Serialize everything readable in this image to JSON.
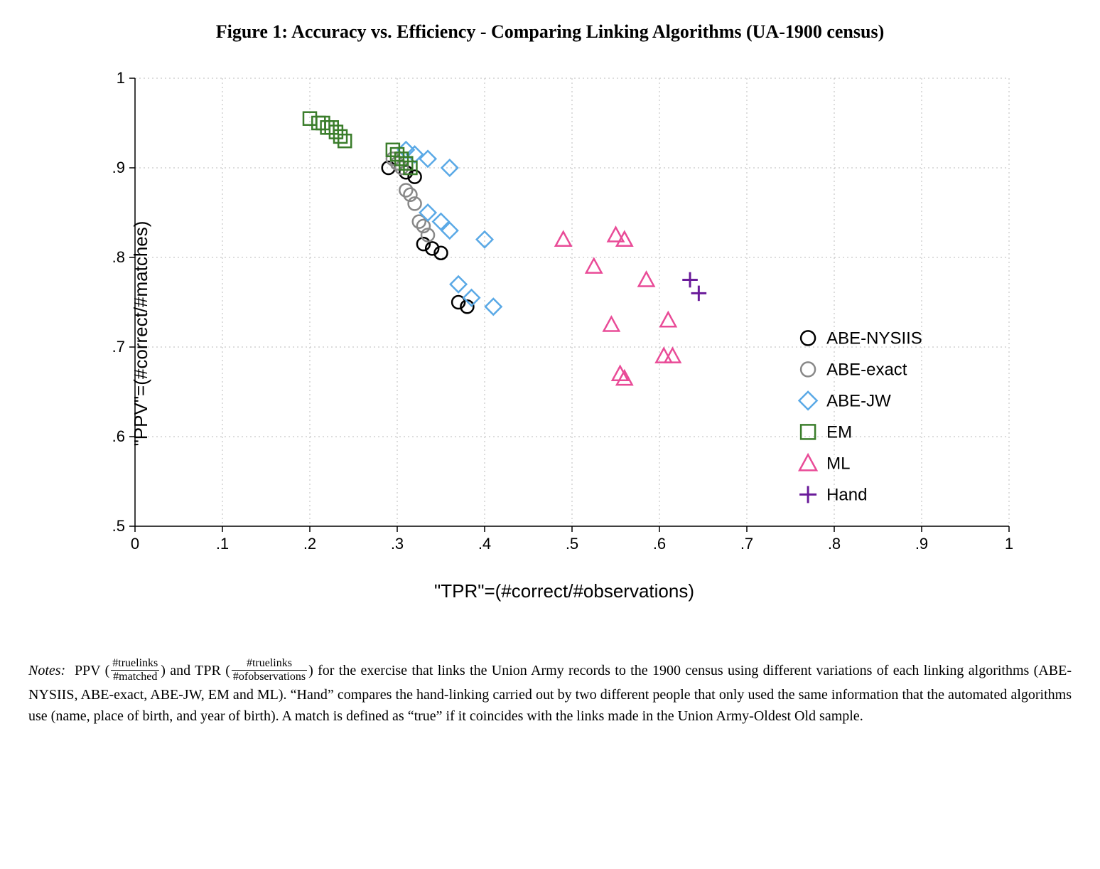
{
  "title": "Figure 1: Accuracy vs. Efficiency - Comparing Linking Algorithms (UA-1900 census)",
  "xlabel": "\"TPR\"=(#correct/#observations)",
  "ylabel": "\"PPV\"=(#correct/#matches)",
  "notes": {
    "lead": "Notes:",
    "ppv_label": "PPV",
    "ppv_num": "#truelinks",
    "ppv_den": "#matched",
    "tpr_label": "TPR",
    "tpr_num": "#truelinks",
    "tpr_den": "#ofobservations",
    "body": "for the exercise that links the Union Army records to the 1900 census using different variations of each linking algorithms (ABE-NYSIIS, ABE-exact, ABE-JW, EM and ML). “Hand” compares the hand-linking carried out by two different people that only used the same information that the automated algorithms use (name, place of birth, and year of birth). A match is defined as “true” if it coincides with the links made in the Union Army-Oldest Old sample."
  },
  "legend": [
    {
      "key": "ABE-NYSIIS",
      "label": "ABE-NYSIIS"
    },
    {
      "key": "ABE-exact",
      "label": "ABE-exact"
    },
    {
      "key": "ABE-JW",
      "label": "ABE-JW"
    },
    {
      "key": "EM",
      "label": "EM"
    },
    {
      "key": "ML",
      "label": "ML"
    },
    {
      "key": "Hand",
      "label": "Hand"
    }
  ],
  "chart_data": {
    "type": "scatter",
    "title": "Accuracy vs. Efficiency - Comparing Linking Algorithms (UA-1900 census)",
    "xlabel": "\"TPR\"=(#correct/#observations)",
    "ylabel": "\"PPV\"=(#correct/#matches)",
    "xlim": [
      0,
      1
    ],
    "ylim": [
      0.5,
      1
    ],
    "xticks": [
      0,
      0.1,
      0.2,
      0.3,
      0.4,
      0.5,
      0.6,
      0.7,
      0.8,
      0.9,
      1
    ],
    "xtick_labels": [
      "0",
      ".1",
      ".2",
      ".3",
      ".4",
      ".5",
      ".6",
      ".7",
      ".8",
      ".9",
      "1"
    ],
    "yticks": [
      0.5,
      0.6,
      0.7,
      0.8,
      0.9,
      1
    ],
    "ytick_labels": [
      ".5",
      ".6",
      ".7",
      ".8",
      ".9",
      "1"
    ],
    "legend_position": "right-inside",
    "grid": true,
    "series": [
      {
        "name": "ABE-NYSIIS",
        "marker": "circle-open",
        "color": "#000000",
        "points": [
          [
            0.29,
            0.9
          ],
          [
            0.31,
            0.895
          ],
          [
            0.32,
            0.89
          ],
          [
            0.33,
            0.815
          ],
          [
            0.34,
            0.81
          ],
          [
            0.35,
            0.805
          ],
          [
            0.37,
            0.75
          ],
          [
            0.38,
            0.745
          ]
        ]
      },
      {
        "name": "ABE-exact",
        "marker": "circle-open",
        "color": "#888888",
        "points": [
          [
            0.295,
            0.91
          ],
          [
            0.3,
            0.905
          ],
          [
            0.305,
            0.9
          ],
          [
            0.31,
            0.875
          ],
          [
            0.315,
            0.87
          ],
          [
            0.32,
            0.86
          ],
          [
            0.325,
            0.84
          ],
          [
            0.33,
            0.835
          ],
          [
            0.335,
            0.825
          ]
        ]
      },
      {
        "name": "ABE-JW",
        "marker": "diamond-open",
        "color": "#5aa9e6",
        "points": [
          [
            0.31,
            0.92
          ],
          [
            0.32,
            0.915
          ],
          [
            0.335,
            0.91
          ],
          [
            0.36,
            0.9
          ],
          [
            0.335,
            0.85
          ],
          [
            0.35,
            0.84
          ],
          [
            0.36,
            0.83
          ],
          [
            0.4,
            0.82
          ],
          [
            0.37,
            0.77
          ],
          [
            0.385,
            0.755
          ],
          [
            0.41,
            0.745
          ]
        ]
      },
      {
        "name": "EM",
        "marker": "square-open",
        "color": "#3a7d2b",
        "points": [
          [
            0.2,
            0.955
          ],
          [
            0.21,
            0.95
          ],
          [
            0.215,
            0.95
          ],
          [
            0.22,
            0.945
          ],
          [
            0.225,
            0.945
          ],
          [
            0.23,
            0.94
          ],
          [
            0.235,
            0.935
          ],
          [
            0.24,
            0.93
          ],
          [
            0.295,
            0.92
          ],
          [
            0.3,
            0.915
          ],
          [
            0.305,
            0.91
          ],
          [
            0.31,
            0.905
          ],
          [
            0.315,
            0.9
          ]
        ]
      },
      {
        "name": "ML",
        "marker": "triangle-open",
        "color": "#e94b97",
        "points": [
          [
            0.49,
            0.82
          ],
          [
            0.55,
            0.825
          ],
          [
            0.56,
            0.82
          ],
          [
            0.525,
            0.79
          ],
          [
            0.585,
            0.775
          ],
          [
            0.545,
            0.725
          ],
          [
            0.61,
            0.73
          ],
          [
            0.605,
            0.69
          ],
          [
            0.615,
            0.69
          ],
          [
            0.555,
            0.67
          ],
          [
            0.56,
            0.665
          ]
        ]
      },
      {
        "name": "Hand",
        "marker": "plus",
        "color": "#6a1b9a",
        "points": [
          [
            0.635,
            0.775
          ],
          [
            0.645,
            0.76
          ]
        ]
      }
    ]
  }
}
